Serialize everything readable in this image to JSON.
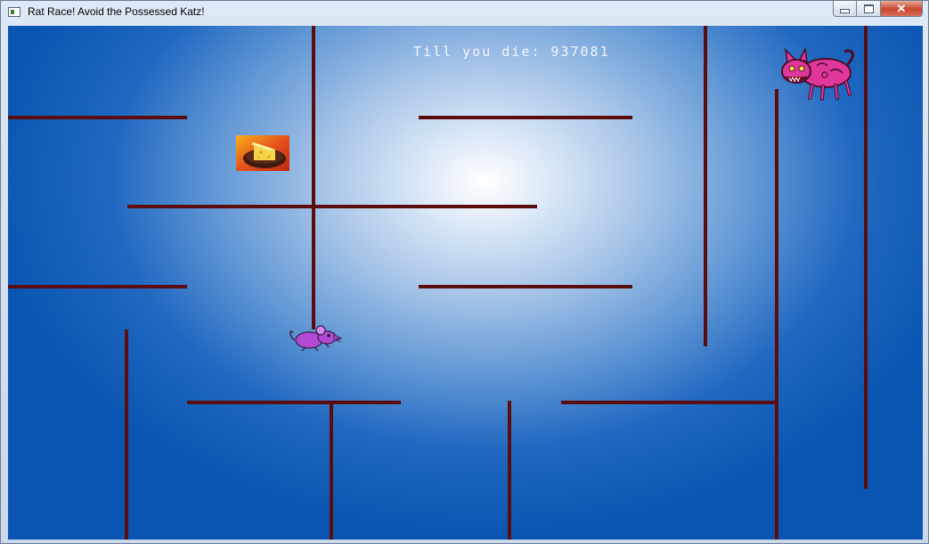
{
  "window": {
    "title": "Rat Race!  Avoid the Possessed Katz!",
    "controls": {
      "minimize": "minimize-icon",
      "maximize": "maximize-icon",
      "close_glyph": "✕"
    }
  },
  "hud": {
    "timer_text": "Till you die: 937081"
  },
  "sprites": {
    "cheese": "cheese-icon",
    "rat": "rat-icon",
    "cat": "possessed-cat-icon"
  },
  "colors": {
    "wall": "#5b0d0d",
    "background_center": "#ffffff",
    "background_edge": "#0a55b2",
    "rat": "#b24ad6",
    "cat": "#e0379b"
  }
}
